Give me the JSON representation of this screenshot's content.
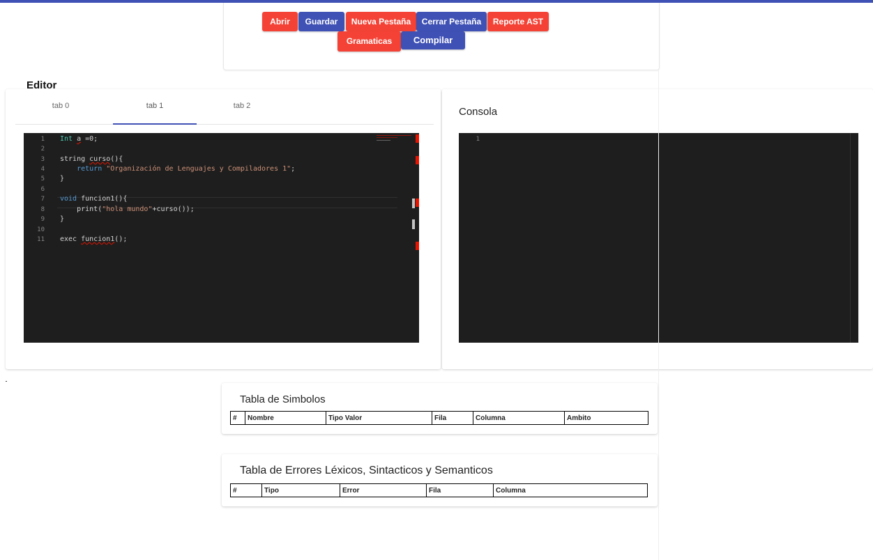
{
  "toolbar": {
    "buttons": {
      "abrir": "Abrir",
      "guardar": "Guardar",
      "nueva": "Nueva Pestaña",
      "cerrar": "Cerrar Pestaña",
      "reporte": "Reporte AST",
      "gramaticas": "Gramaticas",
      "compilar": "Compilar"
    }
  },
  "editor": {
    "title": "Editor",
    "tabs": [
      "tab 0",
      "tab 1",
      "tab 2"
    ],
    "active_tab": "tab 1",
    "line_numbers": [
      "1",
      "2",
      "3",
      "4",
      "5",
      "6",
      "7",
      "8",
      "9",
      "10",
      "11"
    ]
  },
  "console": {
    "title": "Consola",
    "line_number": "1"
  },
  "symbols_table": {
    "title": "Tabla de Simbolos",
    "headers": [
      "#",
      "Nombre",
      "Tipo Valor",
      "Fila",
      "Columna",
      "Ambito"
    ]
  },
  "errors_table": {
    "title": "Tabla de Errores Léxicos, Sintacticos y Semanticos",
    "headers": [
      "#",
      "Tipo",
      "Error",
      "Fila",
      "Columna"
    ]
  },
  "code": {
    "l1_type": "Int",
    "l1_var": "a",
    "l1_rest": " =0;",
    "l3_type": "string",
    "l3_name": "curso",
    "l3_rest": "(){",
    "l4_kw": "return",
    "l4_str": "\"Organización de Lenguajes y Compiladores 1\"",
    "l4_end": ";",
    "l5": "}",
    "l7_kw": "void",
    "l7_rest": " funcion1(){",
    "l8_fn": "print(",
    "l8_str": "\"hola mundo\"",
    "l8_rest": "+curso());",
    "l9": "}",
    "l11_kw": "exec",
    "l11_name": "funcion1",
    "l11_rest": "();"
  },
  "colors": {
    "primary": "#3f51b5",
    "accent": "#f44336",
    "editor_bg": "#1e1e1e"
  }
}
